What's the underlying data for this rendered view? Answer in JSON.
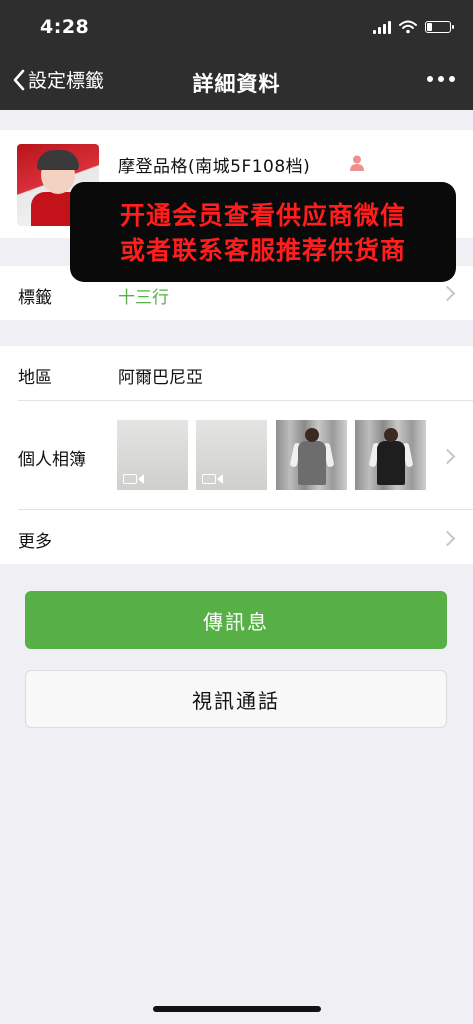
{
  "status_bar": {
    "time": "4:28"
  },
  "nav": {
    "back_label": "設定標籤",
    "title": "詳細資料"
  },
  "profile": {
    "name": "摩登品格(南城5F108档)"
  },
  "promo": {
    "line1": "开通会员查看供应商微信",
    "line2": "或者联系客服推荐供货商"
  },
  "tag_row": {
    "label": "標籤",
    "value": "十三行",
    "value_color": "#57b046"
  },
  "region": {
    "label": "地區",
    "value": "阿爾巴尼亞"
  },
  "album": {
    "label": "個人相簿",
    "thumbnails": [
      {
        "kind": "video",
        "icon": "video-icon"
      },
      {
        "kind": "video",
        "icon": "video-icon"
      },
      {
        "kind": "photo",
        "dress_color": "#6d6d6d"
      },
      {
        "kind": "photo",
        "dress_color": "#1e1e1e"
      }
    ]
  },
  "more": {
    "label": "更多"
  },
  "buttons": {
    "send_message": "傳訊息",
    "video_call": "視訊通話"
  },
  "colors": {
    "accent_green": "#57b046",
    "promo_text": "#ff1d1d",
    "nav_bg": "#2e2e2e"
  }
}
